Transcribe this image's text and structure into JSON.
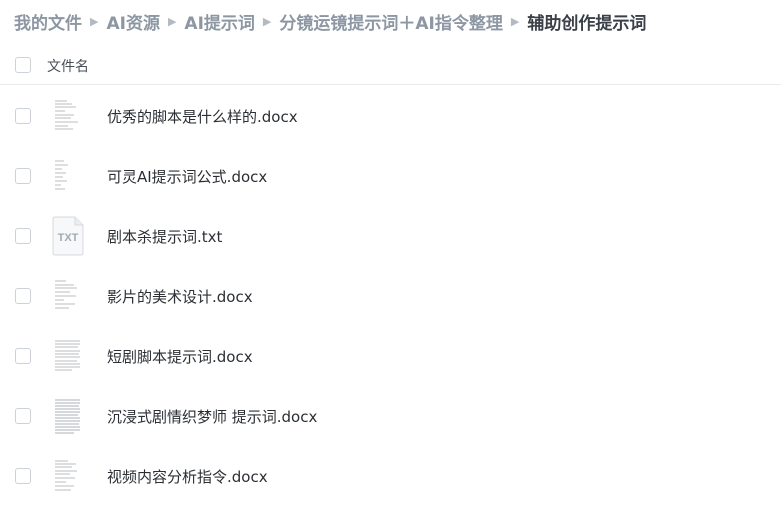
{
  "breadcrumb": {
    "items": [
      "我的文件",
      "AI资源",
      "AI提示词",
      "分镜运镜提示词＋AI指令整理",
      "辅助创作提示词"
    ]
  },
  "header": {
    "column_label": "文件名"
  },
  "files": [
    {
      "name": "优秀的脚本是什么样的.docx",
      "type": "docx"
    },
    {
      "name": "可灵AI提示词公式.docx",
      "type": "docx"
    },
    {
      "name": "剧本杀提示词.txt",
      "type": "txt",
      "icon_label": "TXT"
    },
    {
      "name": "影片的美术设计.docx",
      "type": "docx"
    },
    {
      "name": "短剧脚本提示词.docx",
      "type": "docx"
    },
    {
      "name": "沉浸式剧情织梦师 提示词.docx",
      "type": "docx"
    },
    {
      "name": "视频内容分析指令.docx",
      "type": "docx"
    }
  ],
  "colors": {
    "crumb": "#8d97a3",
    "crumb_current": "#3a4048",
    "divider": "#e8eaed"
  }
}
